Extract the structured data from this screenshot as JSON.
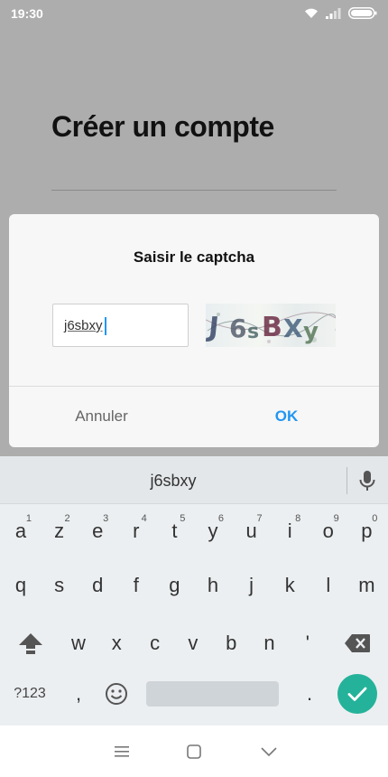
{
  "status_bar": {
    "time": "19:30",
    "icons": [
      "wifi-icon",
      "signal-icon",
      "battery-icon"
    ]
  },
  "background": {
    "title": "Créer un compte"
  },
  "dialog": {
    "title": "Saisir le captcha",
    "input_value": "j6sbxy",
    "captcha_image_text": "J6sBXy",
    "cancel_label": "Annuler",
    "ok_label": "OK",
    "accent_color": "#2196f3"
  },
  "keyboard": {
    "suggestion": "j6sbxy",
    "row1": [
      {
        "k": "a",
        "h": "1"
      },
      {
        "k": "z",
        "h": "2"
      },
      {
        "k": "e",
        "h": "3"
      },
      {
        "k": "r",
        "h": "4"
      },
      {
        "k": "t",
        "h": "5"
      },
      {
        "k": "y",
        "h": "6"
      },
      {
        "k": "u",
        "h": "7"
      },
      {
        "k": "i",
        "h": "8"
      },
      {
        "k": "o",
        "h": "9"
      },
      {
        "k": "p",
        "h": "0"
      }
    ],
    "row2": [
      "q",
      "s",
      "d",
      "f",
      "g",
      "h",
      "j",
      "k",
      "l",
      "m"
    ],
    "row3": [
      "w",
      "x",
      "c",
      "v",
      "b",
      "n",
      "'"
    ],
    "symbols_label": "?123",
    "comma_label": ",",
    "period_label": ".",
    "enter_color": "#25b29a",
    "icons": [
      "shift-icon",
      "backspace-icon",
      "emoji-icon",
      "mic-icon",
      "check-icon"
    ]
  },
  "nav_bar": {
    "icons": [
      "menu-icon",
      "home-icon",
      "back-icon"
    ]
  }
}
